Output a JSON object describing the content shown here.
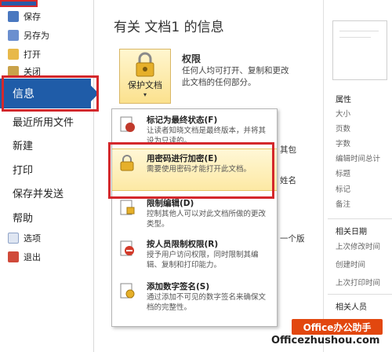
{
  "nav": {
    "items_small": [
      {
        "label": "保存",
        "icon": "save-icon"
      },
      {
        "label": "另存为",
        "icon": "save-as-icon"
      },
      {
        "label": "打开",
        "icon": "open-folder-icon"
      },
      {
        "label": "关闭",
        "icon": "close-doc-icon"
      }
    ],
    "info": "信息",
    "recent": "最近所用文件",
    "new": "新建",
    "print": "打印",
    "save_send": "保存并发送",
    "help": "帮助",
    "options": "选项",
    "exit": "退出"
  },
  "main": {
    "title": "有关 文档1 的信息",
    "protect_button": "保护文档",
    "permissions_title": "权限",
    "permissions_desc": "任何人均可打开、复制和更改此文档的任何部分。",
    "bg_text_1": "其包",
    "bg_text_2": "姓名",
    "bg_text_3": "一个版"
  },
  "menu": {
    "items": [
      {
        "title": "标记为最终状态(F)",
        "desc": "让读者知晓文档是最终版本，并将其设为只读的。",
        "icon": "final-mark-icon"
      },
      {
        "title": "用密码进行加密(E)",
        "desc": "需要使用密码才能打开此文档。",
        "icon": "lock-key-icon"
      },
      {
        "title": "限制编辑(D)",
        "desc": "控制其他人可以对此文档所做的更改类型。",
        "icon": "restrict-edit-icon"
      },
      {
        "title": "按人员限制权限(R)",
        "desc": "授予用户访问权限，同时限制其编辑、复制和打印能力。",
        "icon": "no-entry-icon"
      },
      {
        "title": "添加数字签名(S)",
        "desc": "通过添加不可见的数字签名来确保文档的完整性。",
        "icon": "signature-icon"
      }
    ]
  },
  "properties": {
    "header": "属性",
    "fields": [
      "大小",
      "页数",
      "字数",
      "编辑时间总计",
      "标题",
      "标记",
      "备注"
    ],
    "dates_header": "相关日期",
    "dates": [
      "上次修改时间",
      "创建时间",
      "上次打印时间"
    ],
    "people_header": "相关人员"
  },
  "watermark": {
    "badge": "Office办公助手",
    "site": "Officezhushou.com"
  },
  "colors": {
    "accent": "#1f5ca8",
    "highlight_red": "#d4282c",
    "selected_gold": "#fde9a4",
    "watermark_orange": "#e2470f"
  }
}
